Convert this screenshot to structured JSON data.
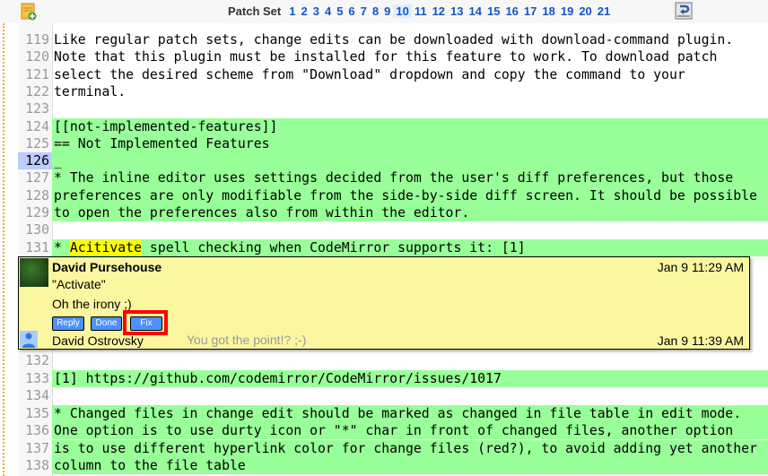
{
  "header": {
    "patch_set_label": "Patch Set",
    "patch_sets": [
      "1",
      "2",
      "3",
      "4",
      "5",
      "6",
      "7",
      "8",
      "9",
      "10",
      "11",
      "12",
      "13",
      "14",
      "15",
      "16",
      "17",
      "18",
      "19",
      "20",
      "21"
    ],
    "current_patch_set": "10"
  },
  "colors": {
    "inserted": "#99ff99",
    "highlight": "#ffff00",
    "comment_bg": "#fbf7a0",
    "button": "#4d90fe",
    "current_line": "#bbccff"
  },
  "lines_before": [
    {
      "n": "119",
      "t": "Like regular patch sets, change edits can be downloaded with download-command plugin.",
      "ins": false
    },
    {
      "n": "120",
      "t": "Note that this plugin must be installed for this feature to work. To download patch",
      "ins": false
    },
    {
      "n": "121",
      "t": "select the desired scheme from \"Download\" dropdown and copy the command to your",
      "ins": false
    },
    {
      "n": "122",
      "t": "terminal.",
      "ins": false
    },
    {
      "n": "123",
      "t": "",
      "ins": false
    },
    {
      "n": "124",
      "t": "[[not-implemented-features]]",
      "ins": true
    },
    {
      "n": "125",
      "t": "== Not Implemented Features",
      "ins": true
    },
    {
      "n": "126",
      "t": "_",
      "ins": true,
      "cur": true
    },
    {
      "n": "127",
      "t": "* The inline editor uses settings decided from the user's diff preferences, but those",
      "ins": true
    },
    {
      "n": "128",
      "t": "preferences are only modifiable from the side-by-side diff screen. It should be possible",
      "ins": true
    },
    {
      "n": "129",
      "t": "to open the preferences also from within the editor.",
      "ins": true
    },
    {
      "n": "130",
      "t": "",
      "ins": true
    }
  ],
  "line131": {
    "n": "131",
    "pre": "* ",
    "hl": "Acitivate",
    "post": " spell checking when CodeMirror supports it: [1]"
  },
  "comment": {
    "author": "David Pursehouse",
    "date": "Jan 9 11:29 AM",
    "quote": "\"Activate\"",
    "message": "Oh the irony ;)",
    "buttons": {
      "reply": "Reply",
      "done": "Done",
      "fix": "Fix"
    },
    "reply": {
      "author": "David Ostrovsky",
      "message": "You got the point!? ;-)",
      "date": "Jan 9 11:39 AM"
    }
  },
  "lines_after": [
    {
      "n": "132",
      "t": ""
    },
    {
      "n": "133",
      "t": "[1] https://github.com/codemirror/CodeMirror/issues/1017"
    },
    {
      "n": "134",
      "t": ""
    },
    {
      "n": "135",
      "t": "* Changed files in change edit should be marked as changed in file table in edit mode."
    },
    {
      "n": "136",
      "t": "One option is to use durty icon or \"*\" char in front of changed files, another option"
    },
    {
      "n": "137",
      "t": "is to use different hyperlink color for change files (red?), to avoid adding yet another"
    },
    {
      "n": "138",
      "t": "column to the file table"
    }
  ]
}
